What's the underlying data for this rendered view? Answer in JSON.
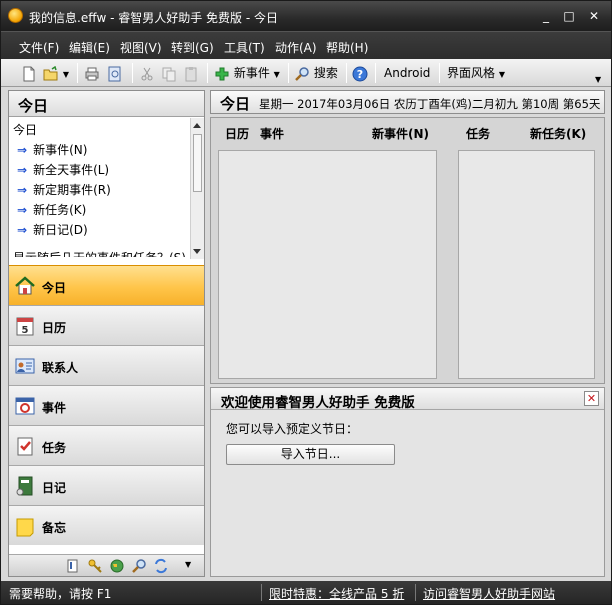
{
  "window": {
    "title": "我的信息.effw - 睿智男人好助手 免费版 - 今日",
    "minimize_label": "_",
    "maximize_label": "□",
    "close_label": "✕"
  },
  "menu": [
    "文件(F)",
    "编辑(E)",
    "视图(V)",
    "转到(G)",
    "工具(T)",
    "动作(A)",
    "帮助(H)"
  ],
  "toolbar": {
    "new_event_label": "新事件",
    "search_label": "搜索",
    "android_label": "Android",
    "skin_label": "界面风格"
  },
  "sidebar": {
    "header": "今日",
    "quick_title": "今日",
    "quick_items": [
      "新事件(N)",
      "新全天事件(L)",
      "新定期事件(R)",
      "新任务(K)",
      "新日记(D)"
    ],
    "quick_cut_text": "显示随后几天的事件和任务？(S)",
    "nav": [
      {
        "label": "今日",
        "icon": "home-icon",
        "active": true
      },
      {
        "label": "日历",
        "icon": "calendar-icon",
        "active": false
      },
      {
        "label": "联系人",
        "icon": "contacts-icon",
        "active": false
      },
      {
        "label": "事件",
        "icon": "event-icon",
        "active": false
      },
      {
        "label": "任务",
        "icon": "task-icon",
        "active": false
      },
      {
        "label": "日记",
        "icon": "diary-icon",
        "active": false
      },
      {
        "label": "备忘",
        "icon": "memo-icon",
        "active": false
      }
    ]
  },
  "today": {
    "title": "今日",
    "date_line": "星期一 2017年03月06日 农历丁酉年(鸡)二月初九 第10周 第65天"
  },
  "schedule": {
    "calendar_label": "日历",
    "events_label": "事件",
    "new_event_label": "新事件(N)",
    "tasks_label": "任务",
    "new_task_label": "新任务(K)"
  },
  "welcome": {
    "title": "欢迎使用睿智男人好助手 免费版",
    "text": "您可以导入预定义节日：",
    "import_button": "导入节日..."
  },
  "status": {
    "help": "需要帮助，请按 F1",
    "promo": "限时特惠：全线产品 5 折",
    "visit": "访问睿智男人好助手网站"
  },
  "colors": {
    "active_nav": "#ffc54a",
    "title_bar": "#2a2a2a",
    "close_red": "#c4161c"
  }
}
